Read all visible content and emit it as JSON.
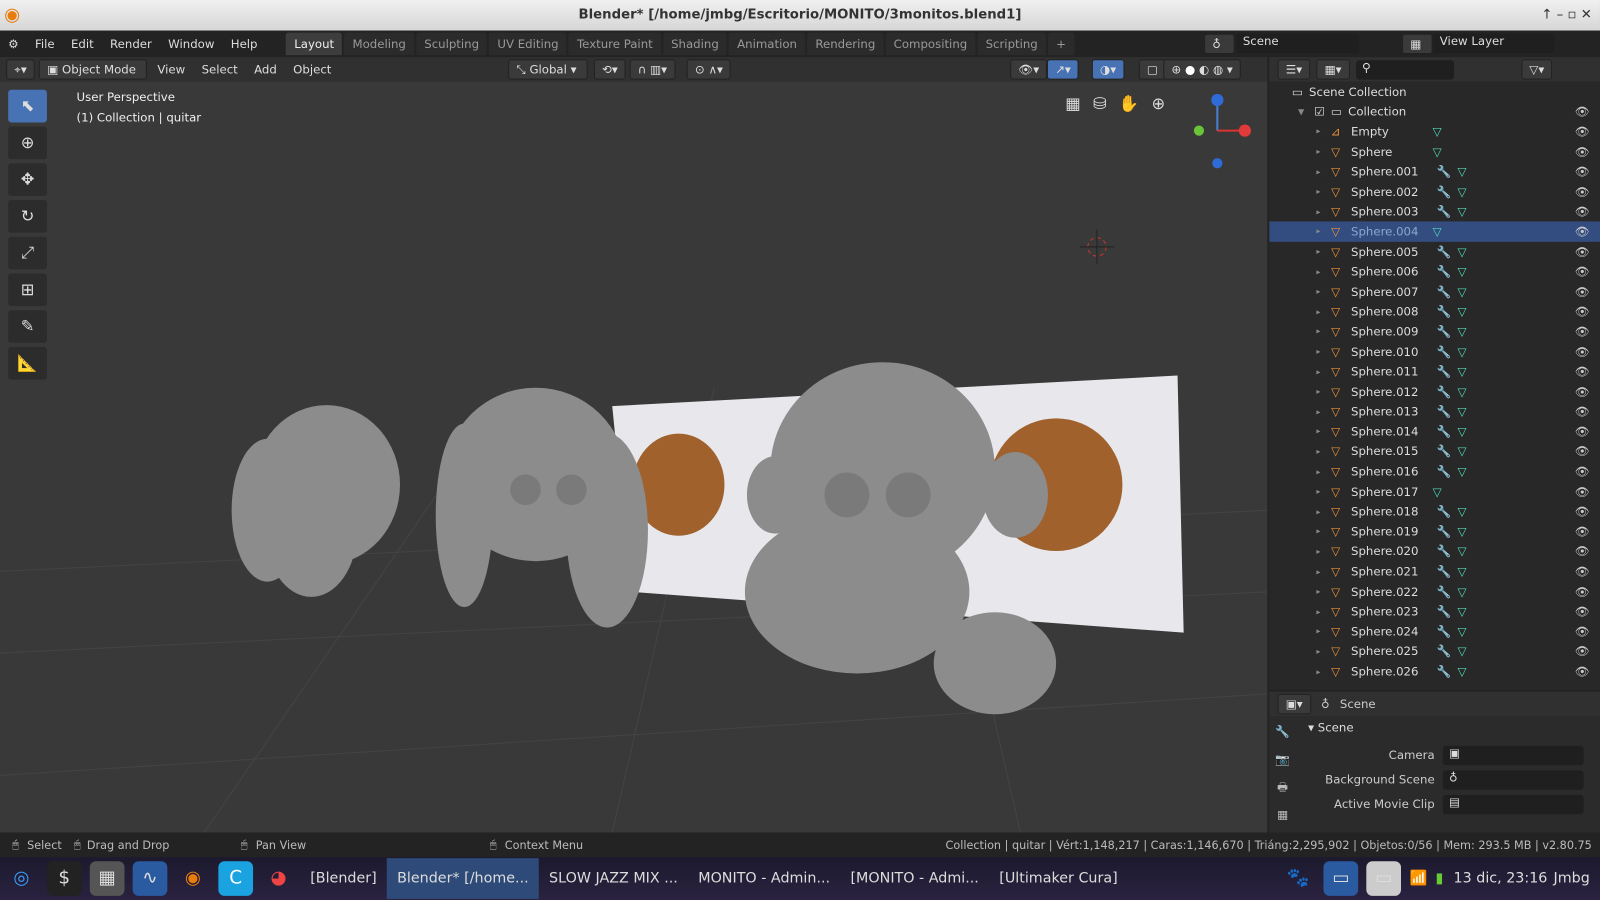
{
  "window": {
    "title": "Blender* [/home/jmbg/Escritorio/MONITO/3monitos.blend1]"
  },
  "menu": [
    "File",
    "Edit",
    "Render",
    "Window",
    "Help"
  ],
  "workspaces": [
    "Layout",
    "Modeling",
    "Sculpting",
    "UV Editing",
    "Texture Paint",
    "Shading",
    "Animation",
    "Rendering",
    "Compositing",
    "Scripting"
  ],
  "active_workspace": "Layout",
  "scene": {
    "label": "Scene",
    "view_layer": "View Layer"
  },
  "header": {
    "mode": "Object Mode",
    "view": "View",
    "select": "Select",
    "add": "Add",
    "object": "Object",
    "orientation": "Global"
  },
  "viewport": {
    "perspective": "User Perspective",
    "collection_info": "(1) Collection | quitar"
  },
  "tools": [
    "select-box",
    "cursor",
    "move",
    "rotate",
    "scale",
    "transform",
    "annotate",
    "measure"
  ],
  "outliner": {
    "root": "Scene Collection",
    "collection": "Collection",
    "selected": "Sphere.004",
    "items": [
      {
        "name": "Empty",
        "type": "empty",
        "modifier": false
      },
      {
        "name": "Sphere",
        "type": "mesh",
        "modifier": false
      },
      {
        "name": "Sphere.001",
        "modifier": true
      },
      {
        "name": "Sphere.002",
        "modifier": true
      },
      {
        "name": "Sphere.003",
        "modifier": true
      },
      {
        "name": "Sphere.004",
        "modifier": false
      },
      {
        "name": "Sphere.005",
        "modifier": true
      },
      {
        "name": "Sphere.006",
        "modifier": true
      },
      {
        "name": "Sphere.007",
        "modifier": true
      },
      {
        "name": "Sphere.008",
        "modifier": true
      },
      {
        "name": "Sphere.009",
        "modifier": true
      },
      {
        "name": "Sphere.010",
        "modifier": true
      },
      {
        "name": "Sphere.011",
        "modifier": true
      },
      {
        "name": "Sphere.012",
        "modifier": true
      },
      {
        "name": "Sphere.013",
        "modifier": true
      },
      {
        "name": "Sphere.014",
        "modifier": true
      },
      {
        "name": "Sphere.015",
        "modifier": true
      },
      {
        "name": "Sphere.016",
        "modifier": true
      },
      {
        "name": "Sphere.017",
        "modifier": false
      },
      {
        "name": "Sphere.018",
        "modifier": true
      },
      {
        "name": "Sphere.019",
        "modifier": true
      },
      {
        "name": "Sphere.020",
        "modifier": true
      },
      {
        "name": "Sphere.021",
        "modifier": true
      },
      {
        "name": "Sphere.022",
        "modifier": true
      },
      {
        "name": "Sphere.023",
        "modifier": true
      },
      {
        "name": "Sphere.024",
        "modifier": true
      },
      {
        "name": "Sphere.025",
        "modifier": true
      },
      {
        "name": "Sphere.026",
        "modifier": true
      }
    ]
  },
  "properties": {
    "context": "Scene",
    "panel": "Scene",
    "fields": [
      {
        "label": "Camera",
        "value": ""
      },
      {
        "label": "Background Scene",
        "value": ""
      },
      {
        "label": "Active Movie Clip",
        "value": ""
      }
    ]
  },
  "status": {
    "select": "Select",
    "drag": "Drag and Drop",
    "pan": "Pan View",
    "context": "Context Menu",
    "stats": "Collection | quitar | Vért:1,148,217 | Caras:1,146,670 | Triáng:2,295,902 | Objetos:0/56 | Mem: 293.5 MB | v2.80.75"
  },
  "taskbar": {
    "tasks": [
      "[Blender]",
      "Blender* [/home...",
      "SLOW JAZZ MIX ...",
      "MONITO - Admin...",
      "[MONITO - Admi...",
      "[Ultimaker Cura]"
    ],
    "active_task": 1,
    "clock": "13 dic, 23:16",
    "user": "Jmbg"
  },
  "colors": {
    "accent": "#4772b3",
    "selected_row": "#334d80",
    "object_icon": "#e8913a",
    "mesh_icon": "#4fd8b8"
  }
}
